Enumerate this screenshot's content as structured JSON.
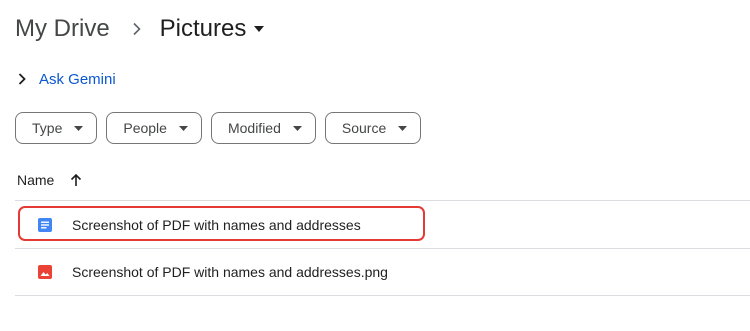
{
  "breadcrumb": {
    "root": "My Drive",
    "current": "Pictures"
  },
  "gemini": {
    "label": "Ask Gemini"
  },
  "filters": [
    {
      "label": "Type"
    },
    {
      "label": "People"
    },
    {
      "label": "Modified"
    },
    {
      "label": "Source"
    }
  ],
  "list": {
    "column_name": "Name",
    "sort_direction": "ascending",
    "files": [
      {
        "name": "Screenshot of PDF with names and addresses",
        "icon": "google-docs-icon",
        "color": "#4285f4",
        "highlighted": true
      },
      {
        "name": "Screenshot of PDF with names and addresses.png",
        "icon": "image-file-icon",
        "color": "#ea4335",
        "highlighted": false
      }
    ]
  },
  "colors": {
    "link": "#0b57d0",
    "highlight_outline": "#e53935",
    "divider": "#dadce0"
  }
}
